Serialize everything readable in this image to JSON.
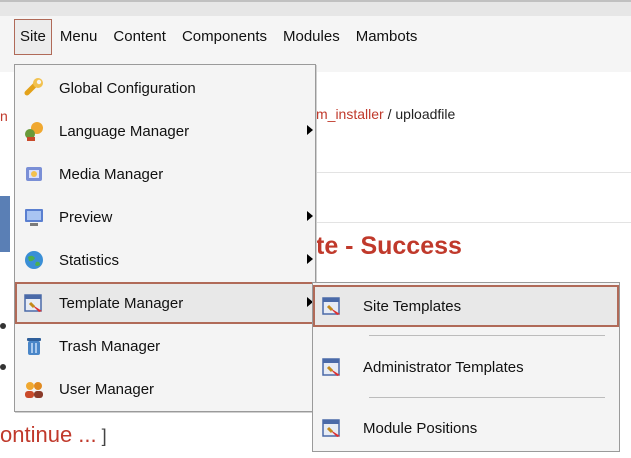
{
  "menubar": {
    "items": [
      "Site",
      "Menu",
      "Content",
      "Components",
      "Modules",
      "Mambots"
    ],
    "active": "Site"
  },
  "background": {
    "breadcrumb_link": "m_installer",
    "breadcrumb_rest": " / uploadfile",
    "left_fragment": "n",
    "title": "te - Success",
    "continue_text": "ontinue ...",
    "continue_bracket": " ]"
  },
  "site_menu": {
    "items": [
      {
        "label": "Global Configuration",
        "icon": "wrench-icon",
        "submenu": false
      },
      {
        "label": "Language Manager",
        "icon": "language-icon",
        "submenu": true
      },
      {
        "label": "Media Manager",
        "icon": "media-icon",
        "submenu": false
      },
      {
        "label": "Preview",
        "icon": "monitor-icon",
        "submenu": true
      },
      {
        "label": "Statistics",
        "icon": "globe-icon",
        "submenu": true
      },
      {
        "label": "Template Manager",
        "icon": "template-icon",
        "submenu": true,
        "highlighted": true
      },
      {
        "label": "Trash Manager",
        "icon": "trash-icon",
        "submenu": false
      },
      {
        "label": "User Manager",
        "icon": "users-icon",
        "submenu": false
      }
    ]
  },
  "template_submenu": {
    "items": [
      {
        "label": "Site Templates",
        "icon": "template-icon",
        "highlighted": true
      },
      {
        "label": "Administrator Templates",
        "icon": "template-icon"
      },
      {
        "label": "Module Positions",
        "icon": "template-icon"
      }
    ]
  },
  "colors": {
    "accent_red": "#c0392b",
    "highlight_border": "#b06a58"
  }
}
